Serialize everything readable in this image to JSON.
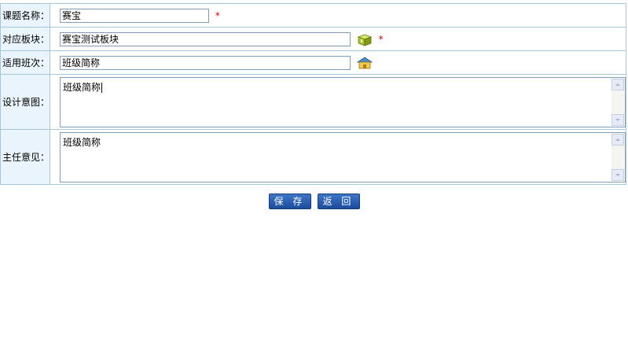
{
  "form": {
    "topic_name": {
      "label": "课题名称：",
      "value": "赛宝",
      "required_mark": "*"
    },
    "module": {
      "label": "对应板块：",
      "value": "赛宝测试板块",
      "required_mark": "*",
      "picker_icon": "module-picker-icon"
    },
    "class": {
      "label": "适用班次：",
      "value": "班级简称",
      "picker_icon": "class-picker-icon"
    },
    "design_intent": {
      "label": "设计意图：",
      "value": "班级简称"
    },
    "director_opinion": {
      "label": "主任意见：",
      "value": "班级简称"
    }
  },
  "buttons": {
    "save": "保 存",
    "back": "返 回"
  },
  "colors": {
    "label_bg": "#e9f4fc",
    "border": "#a5c7dc",
    "required": "#e00000",
    "button_bg": "#2a5fb0"
  }
}
